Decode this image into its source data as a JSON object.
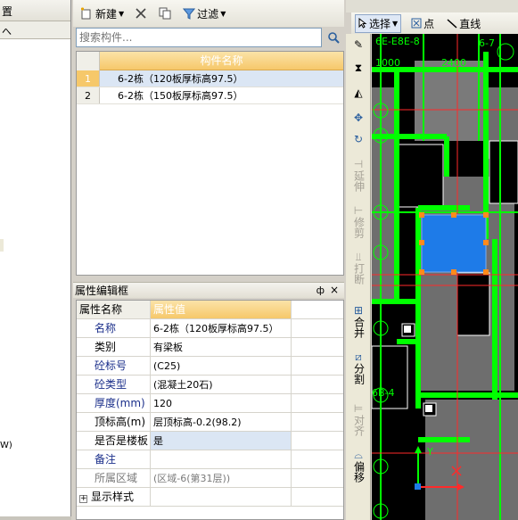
{
  "left_panel": {
    "header_text": "置",
    "subheader_text": "へ",
    "bottom_text": "W)"
  },
  "toolbar": {
    "new_label": "新建",
    "filter_label": "过滤"
  },
  "search": {
    "placeholder": "搜索构件..."
  },
  "component_list": {
    "column_header": "构件名称",
    "rows": [
      {
        "index": "1",
        "name": "6-2栋（120板厚标高97.5）"
      },
      {
        "index": "2",
        "name": "6-2栋（150板厚标高97.5）"
      }
    ]
  },
  "property_panel": {
    "title": "属性编辑框",
    "pin_glyph": "ф",
    "close_glyph": "×",
    "header_name": "属性名称",
    "header_value": "属性值",
    "rows": [
      {
        "name": "名称",
        "value": "6-2栋（120板厚标高97.5）"
      },
      {
        "name": "类别",
        "value": "有梁板"
      },
      {
        "name": "砼标号",
        "value": "(C25)"
      },
      {
        "name": "砼类型",
        "value": "(混凝土20石)"
      },
      {
        "name": "厚度(mm)",
        "value": "120"
      },
      {
        "name": "顶标高(m)",
        "value": "层顶标高-0.2(98.2)"
      },
      {
        "name": "是否是楼板",
        "value": "是"
      },
      {
        "name": "备注",
        "value": ""
      },
      {
        "name": "所属区域",
        "value": "(区域-6(第31层))"
      },
      {
        "name": "显示样式",
        "value": ""
      }
    ]
  },
  "right_toolbar": {
    "select_label": "选择",
    "point_label": "点",
    "line_label": "直线",
    "extend_label": "延伸",
    "trim_label": "修剪",
    "break_label": "打断",
    "merge_label": "合并",
    "split_label": "分割",
    "align_label": "对齐",
    "offset_label": "偏移"
  },
  "cad": {
    "dim1": "1000",
    "dim2": "2400",
    "grid_top1": "6E-E8E-8",
    "grid_top2": "6-7",
    "grid_bottom": "6B-4",
    "axis_y": "Y"
  },
  "colors": {
    "accent_header": "#f6c86a",
    "selection_blue": "#dbe6f4",
    "cad_green": "#00ff00",
    "cad_slab_blue": "#1e7be8"
  }
}
